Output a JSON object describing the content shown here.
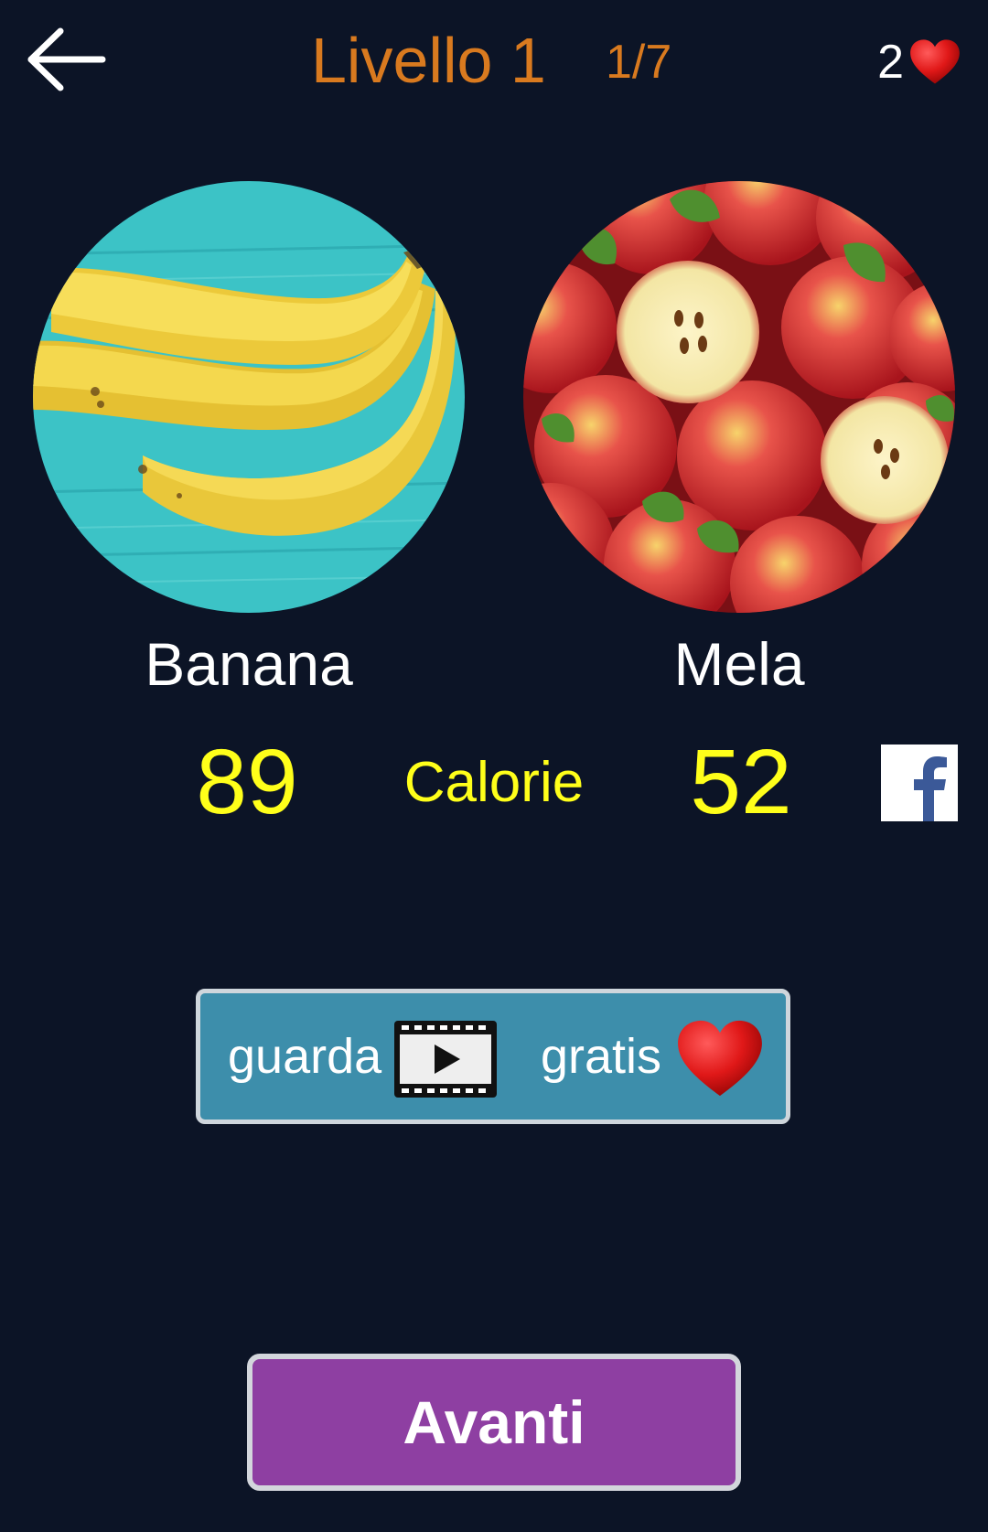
{
  "header": {
    "title": "Livello 1",
    "progress": "1/7",
    "lives": "2"
  },
  "left_item": {
    "name": "Banana",
    "calories": "89",
    "image": "banana-photo"
  },
  "right_item": {
    "name": "Mela",
    "calories": "52",
    "image": "apple-photo"
  },
  "comparison_label": "Calorie",
  "watch_button": {
    "word1": "guarda",
    "word2": "gratis"
  },
  "next_button": {
    "label": "Avanti"
  },
  "colors": {
    "background": "#0c1426",
    "title_orange": "#d97a1f",
    "value_yellow": "#ffff1a",
    "watch_button_bg": "#3d8eab",
    "next_button_bg": "#8e3fa2",
    "heart_red": "#e01818"
  },
  "icons": [
    "back-arrow-icon",
    "heart-icon",
    "facebook-icon",
    "video-film-icon"
  ]
}
